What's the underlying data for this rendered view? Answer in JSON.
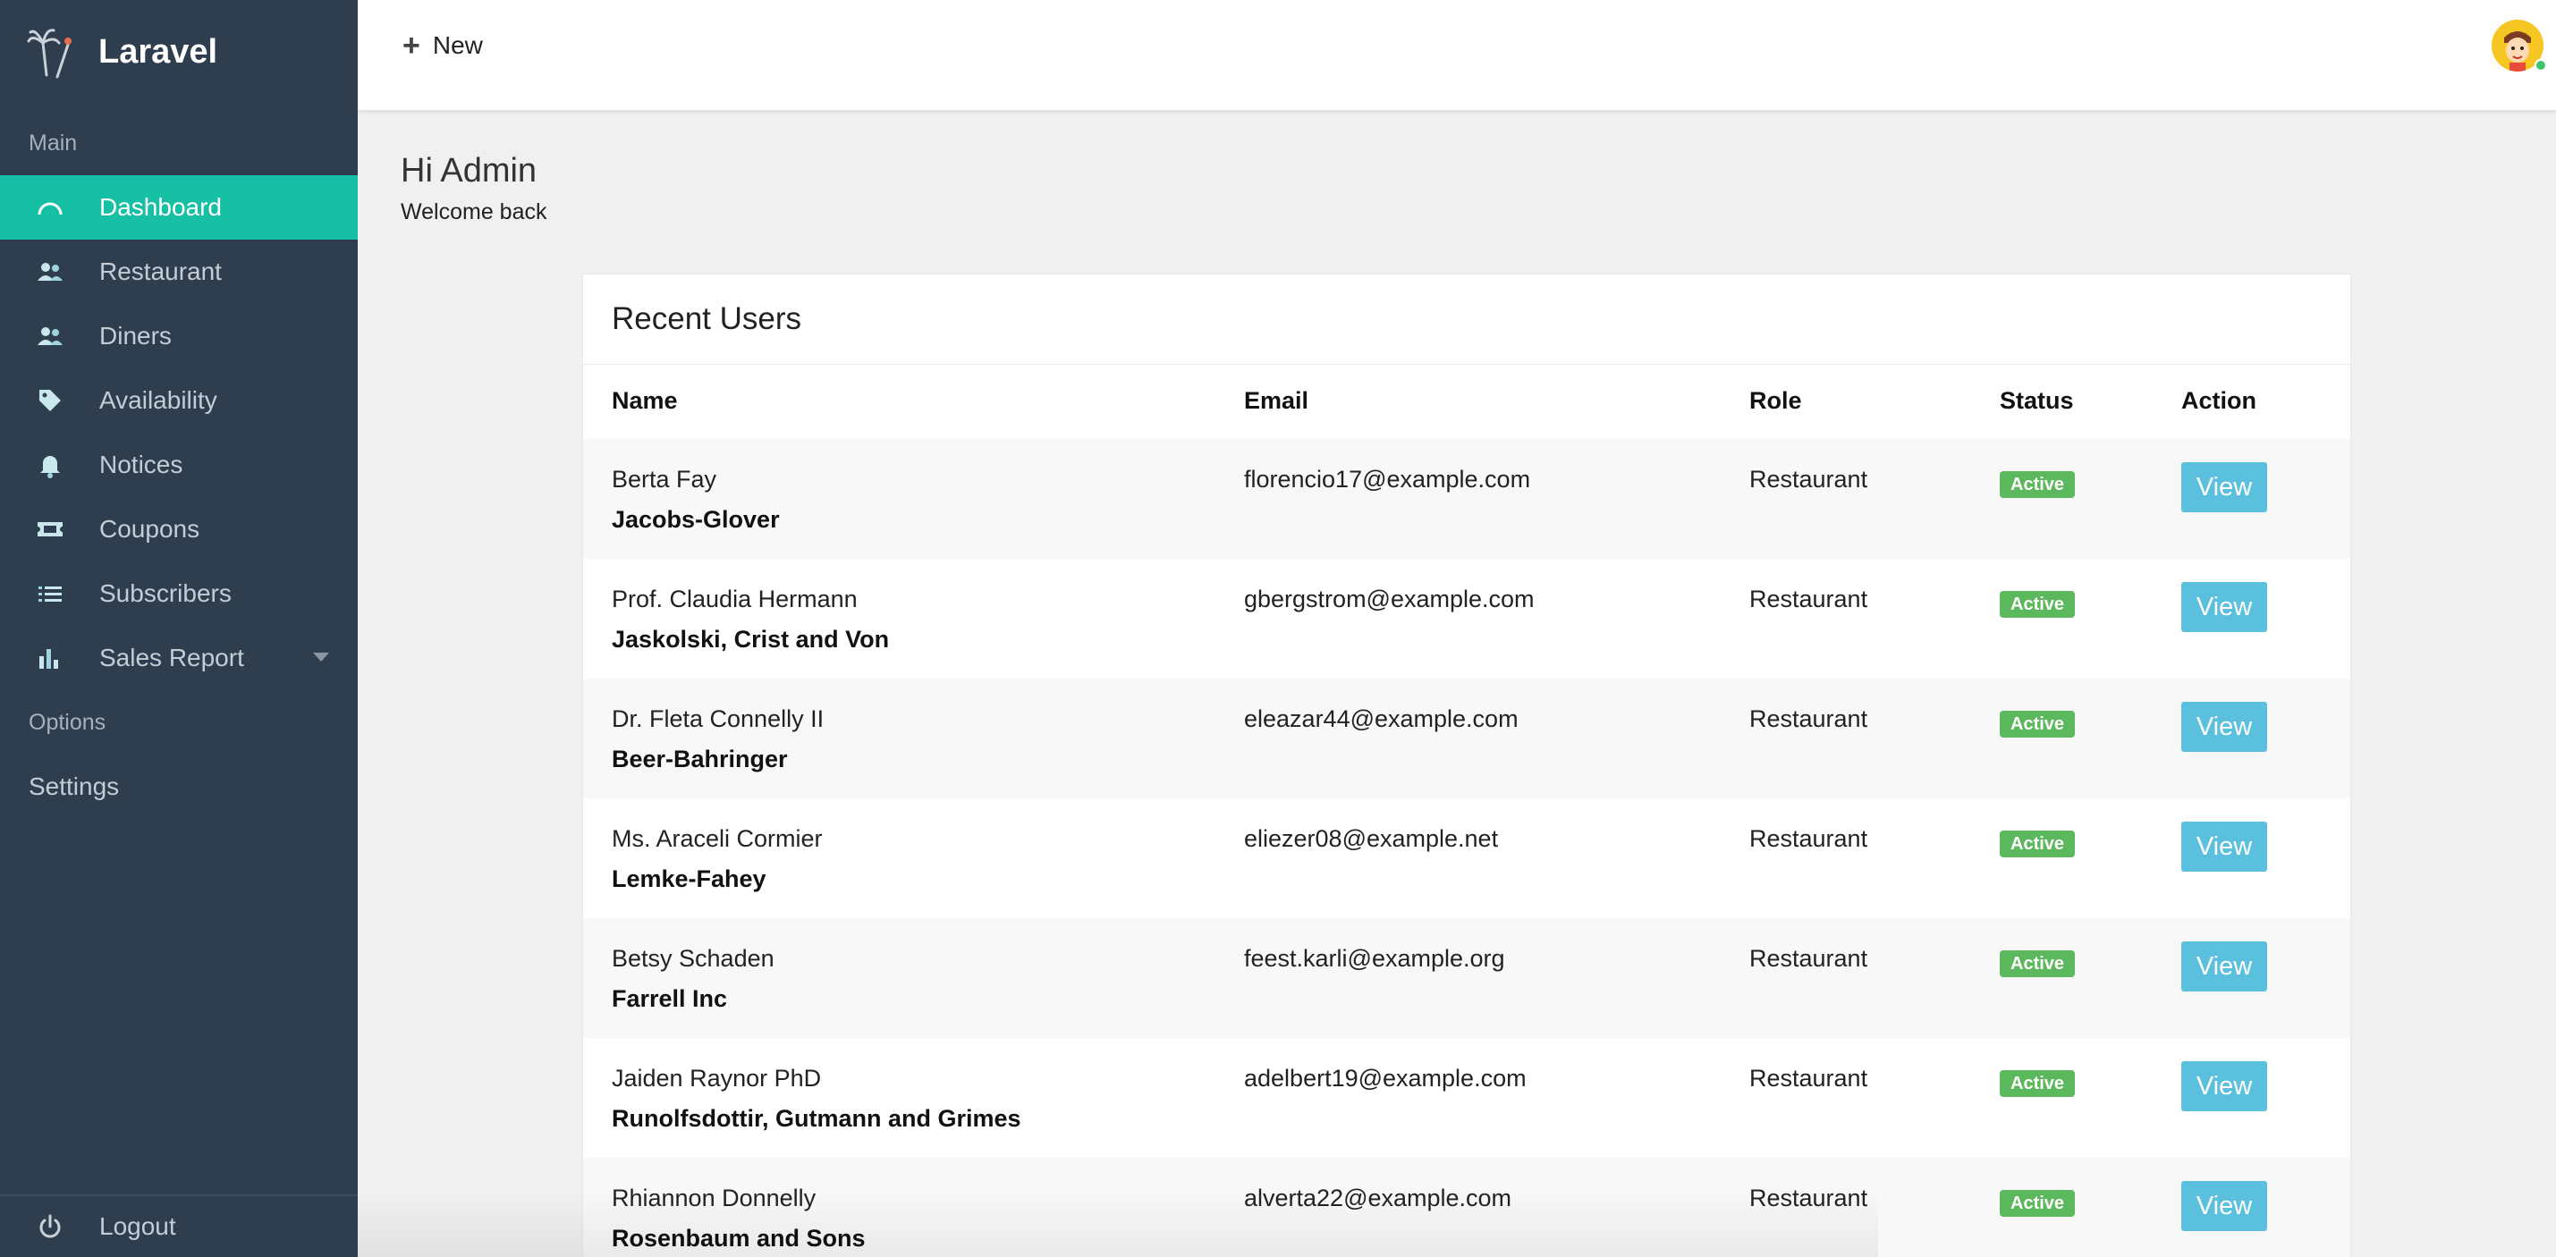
{
  "sidebar": {
    "brand": "Laravel",
    "section_main": "Main",
    "section_options": "Options",
    "items": [
      {
        "label": "Dashboard",
        "icon": "dashboard-gauge-icon"
      },
      {
        "label": "Restaurant",
        "icon": "users-icon"
      },
      {
        "label": "Diners",
        "icon": "users-icon"
      },
      {
        "label": "Availability",
        "icon": "tag-icon"
      },
      {
        "label": "Notices",
        "icon": "bell-icon"
      },
      {
        "label": "Coupons",
        "icon": "ticket-icon"
      },
      {
        "label": "Subscribers",
        "icon": "list-icon"
      },
      {
        "label": "Sales Report",
        "icon": "bar-chart-icon"
      }
    ],
    "settings": "Settings",
    "logout": "Logout"
  },
  "header": {
    "new_label": "New"
  },
  "greeting": {
    "title": "Hi Admin",
    "subtitle": "Welcome back"
  },
  "recent_users": {
    "title": "Recent Users",
    "columns": [
      "Name",
      "Email",
      "Role",
      "Status",
      "Action"
    ],
    "rows": [
      {
        "name": "Berta Fay",
        "company": "Jacobs-Glover",
        "email": "florencio17@example.com",
        "role": "Restaurant",
        "status": "Active",
        "action": "View"
      },
      {
        "name": "Prof. Claudia Hermann",
        "company": "Jaskolski, Crist and Von",
        "email": "gbergstrom@example.com",
        "role": "Restaurant",
        "status": "Active",
        "action": "View"
      },
      {
        "name": "Dr. Fleta Connelly II",
        "company": "Beer-Bahringer",
        "email": "eleazar44@example.com",
        "role": "Restaurant",
        "status": "Active",
        "action": "View"
      },
      {
        "name": "Ms. Araceli Cormier",
        "company": "Lemke-Fahey",
        "email": "eliezer08@example.net",
        "role": "Restaurant",
        "status": "Active",
        "action": "View"
      },
      {
        "name": "Betsy Schaden",
        "company": "Farrell Inc",
        "email": "feest.karli@example.org",
        "role": "Restaurant",
        "status": "Active",
        "action": "View"
      },
      {
        "name": "Jaiden Raynor PhD",
        "company": "Runolfsdottir, Gutmann and Grimes",
        "email": "adelbert19@example.com",
        "role": "Restaurant",
        "status": "Active",
        "action": "View"
      },
      {
        "name": "Rhiannon Donnelly",
        "company": "Rosenbaum and Sons",
        "email": "alverta22@example.com",
        "role": "Restaurant",
        "status": "Active",
        "action": "View"
      }
    ]
  },
  "colors": {
    "sidebar_bg": "#2f3e4e",
    "accent": "#17c0a5",
    "badge_active": "#5cb85c",
    "view_button": "#5bc0de"
  }
}
